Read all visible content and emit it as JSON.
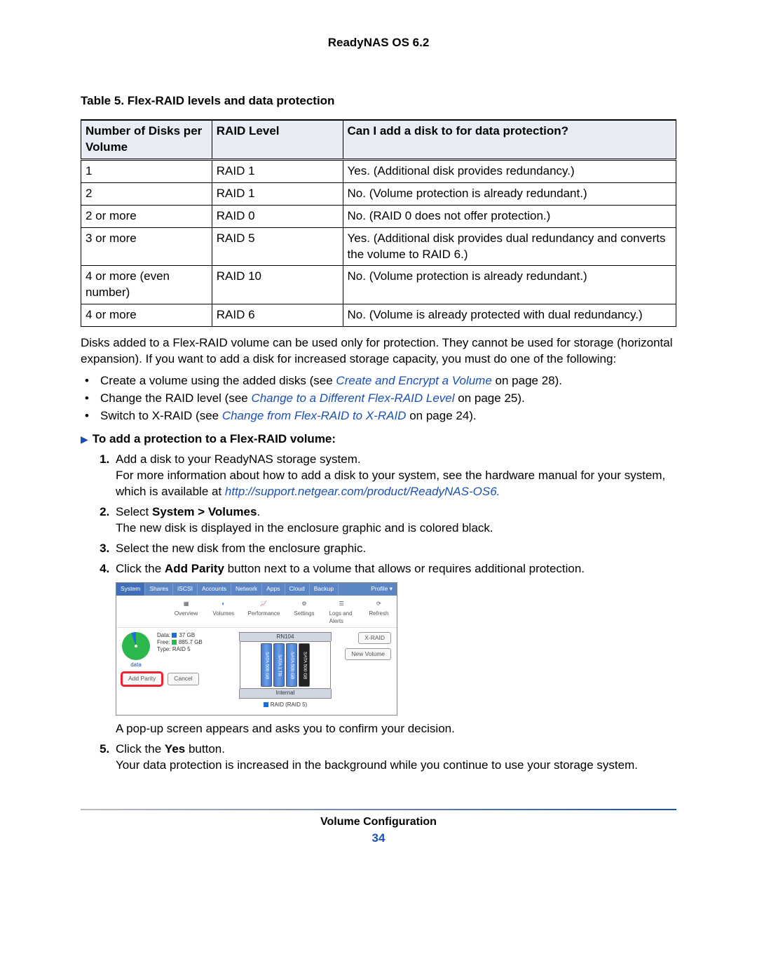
{
  "header": {
    "title": "ReadyNAS OS 6.2"
  },
  "table": {
    "caption": "Table 5. Flex-RAID levels and data protection",
    "headers": {
      "col_a": "Number of Disks per Volume",
      "col_b": "RAID Level",
      "col_c": "Can I add a disk to for data protection?"
    },
    "rows": [
      {
        "a": "1",
        "b": "RAID 1",
        "c": "Yes. (Additional disk provides redundancy.)"
      },
      {
        "a": "2",
        "b": "RAID 1",
        "c": "No. (Volume protection is already redundant.)"
      },
      {
        "a": "2 or more",
        "b": "RAID 0",
        "c": "No. (RAID 0 does not offer protection.)"
      },
      {
        "a": "3 or more",
        "b": "RAID 5",
        "c": "Yes. (Additional disk provides dual redundancy and converts the volume to RAID 6.)"
      },
      {
        "a": "4 or more (even number)",
        "b": "RAID 10",
        "c": "No. (Volume protection is already redundant.)"
      },
      {
        "a": "4 or more",
        "b": "RAID 6",
        "c": "No. (Volume is already protected with dual redundancy.)"
      }
    ]
  },
  "intro_paragraph": "Disks added to a Flex-RAID volume can be used only for protection. They cannot be used for storage (horizontal expansion). If you want to add a disk for increased storage capacity, you must do one of the following:",
  "bullets": [
    {
      "pre": "Create a volume using the added disks (see ",
      "link": "Create and Encrypt a Volume",
      "post": " on page 28)."
    },
    {
      "pre": "Change the RAID level (see ",
      "link": "Change to a Different Flex-RAID Level",
      "post": " on page 25)."
    },
    {
      "pre": "Switch to X-RAID (see ",
      "link": "Change from Flex-RAID to X-RAID",
      "post": " on page 24)."
    }
  ],
  "task_heading": "To add a protection to a Flex-RAID volume:",
  "steps": {
    "s1_a": "Add a disk to your ReadyNAS storage system.",
    "s1_b_pre": "For more information about how to add a disk to your system, see the hardware manual for your system, which is available at ",
    "s1_b_link": "http://support.netgear.com/product/ReadyNAS-OS6.",
    "s2_a_pre": "Select ",
    "s2_a_bold": "System > Volumes",
    "s2_a_post": ".",
    "s2_b": "The new disk is displayed in the enclosure graphic and is colored black.",
    "s3": "Select the new disk from the enclosure graphic.",
    "s4_pre": "Click the ",
    "s4_bold": "Add Parity",
    "s4_post": " button next to a volume that allows or requires additional protection.",
    "s4_after": "A pop-up screen appears and asks you to confirm your decision.",
    "s5_pre": "Click the ",
    "s5_bold": "Yes",
    "s5_post": " button.",
    "s5_after": "Your data protection is increased in the background while you continue to use your storage system."
  },
  "ui": {
    "tabs": [
      "System",
      "Shares",
      "iSCSI",
      "Accounts",
      "Network",
      "Apps",
      "Cloud",
      "Backup",
      "Profile ▾"
    ],
    "icons": {
      "overview": "Overview",
      "volumes": "Volumes",
      "performance": "Performance",
      "settings": "Settings",
      "logs": "Logs and Alerts",
      "refresh": "Refresh"
    },
    "left": {
      "data_label": "Data:",
      "data_value": "37 GB",
      "free_label": "Free:",
      "free_value": "885.7 GB",
      "type_label": "Type:",
      "type_value": "RAID 5",
      "vol_name": "data",
      "btn_add_parity": "Add Parity",
      "btn_cancel": "Cancel"
    },
    "center": {
      "encl_label": "RN104",
      "disk1": "SATA 500 GB",
      "disk2": "SATA 1 TB",
      "disk3": "SATA 500 GB",
      "disk4": "SATA 500 GB",
      "internal": "Internal",
      "raid_chip": "RAID (RAID 5)"
    },
    "right": {
      "btn_xraid": "X-RAID",
      "btn_newvol": "New Volume"
    }
  },
  "footer": {
    "section": "Volume Configuration",
    "page": "34"
  }
}
